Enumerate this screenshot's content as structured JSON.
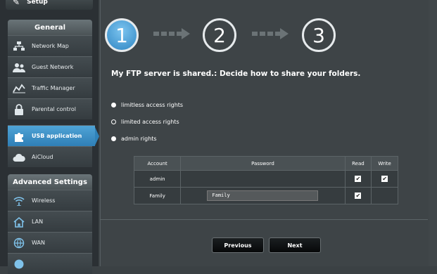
{
  "sidebar": {
    "setup_label": "Setup",
    "general_header": "General",
    "items": [
      {
        "label": "Network Map",
        "icon": "network-map-icon"
      },
      {
        "label": "Guest Network",
        "icon": "guest-network-icon"
      },
      {
        "label": "Traffic Manager",
        "icon": "traffic-manager-icon"
      },
      {
        "label": "Parental control",
        "icon": "lock-icon"
      },
      {
        "label": "USB application",
        "icon": "puzzle-icon"
      },
      {
        "label": "AiCloud",
        "icon": "cloud-icon"
      }
    ],
    "advanced_header": "Advanced Settings",
    "advanced_items": [
      {
        "label": "Wireless",
        "icon": "wireless-icon"
      },
      {
        "label": "LAN",
        "icon": "home-icon"
      },
      {
        "label": "WAN",
        "icon": "globe-icon"
      }
    ]
  },
  "wizard": {
    "steps": [
      "1",
      "2",
      "3"
    ],
    "active_step": "1",
    "title": "My FTP server is shared.: Decide how to share your folders."
  },
  "options": [
    {
      "label": "limitless access rights",
      "selected": false
    },
    {
      "label": "limited access rights",
      "selected": true
    },
    {
      "label": "admin rights",
      "selected": false
    }
  ],
  "table": {
    "headers": {
      "account": "Account",
      "password": "Password",
      "read": "Read",
      "write": "Write"
    },
    "rows": [
      {
        "account": "admin",
        "password": "",
        "read": "✔",
        "write": "✔"
      },
      {
        "account": "Family",
        "password": "Family",
        "read": "✔",
        "write": ""
      }
    ]
  },
  "buttons": {
    "previous": "Previous",
    "next": "Next"
  },
  "colors": {
    "accent": "#2f86c3",
    "background": "#3e4447",
    "sidebar": "#2b3034"
  }
}
